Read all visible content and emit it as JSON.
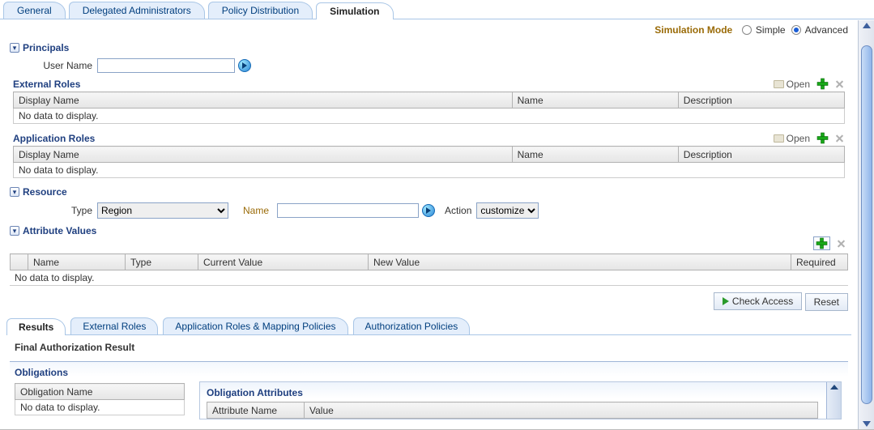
{
  "topTabs": {
    "general": "General",
    "delegated": "Delegated Administrators",
    "policy": "Policy Distribution",
    "simulation": "Simulation"
  },
  "simMode": {
    "label": "Simulation Mode",
    "simple": "Simple",
    "advanced": "Advanced"
  },
  "principals": {
    "title": "Principals",
    "userNameLabel": "User Name",
    "userNameValue": "",
    "external": {
      "title": "External Roles",
      "open": "Open",
      "cols": {
        "display": "Display Name",
        "name": "Name",
        "desc": "Description"
      },
      "noData": "No data to display."
    },
    "app": {
      "title": "Application Roles",
      "open": "Open",
      "cols": {
        "display": "Display Name",
        "name": "Name",
        "desc": "Description"
      },
      "noData": "No data to display."
    }
  },
  "resource": {
    "title": "Resource",
    "typeLabel": "Type",
    "typeValue": "Region",
    "nameLabel": "Name",
    "nameValue": "",
    "actionLabel": "Action",
    "actionValue": "customize"
  },
  "attr": {
    "title": "Attribute Values",
    "cols": {
      "name": "Name",
      "type": "Type",
      "current": "Current Value",
      "newv": "New Value",
      "required": "Required"
    },
    "noData": "No data to display."
  },
  "buttons": {
    "check": "Check Access",
    "reset": "Reset"
  },
  "resTabs": {
    "results": "Results",
    "external": "External Roles",
    "approles": "Application Roles & Mapping Policies",
    "auth": "Authorization Policies"
  },
  "far": "Final Authorization Result",
  "oblig": {
    "title": "Obligations",
    "leftCol": "Obligation Name",
    "leftNoData": "No data to display.",
    "right": {
      "title": "Obligation Attributes",
      "cols": {
        "attr": "Attribute Name",
        "val": "Value"
      }
    }
  }
}
